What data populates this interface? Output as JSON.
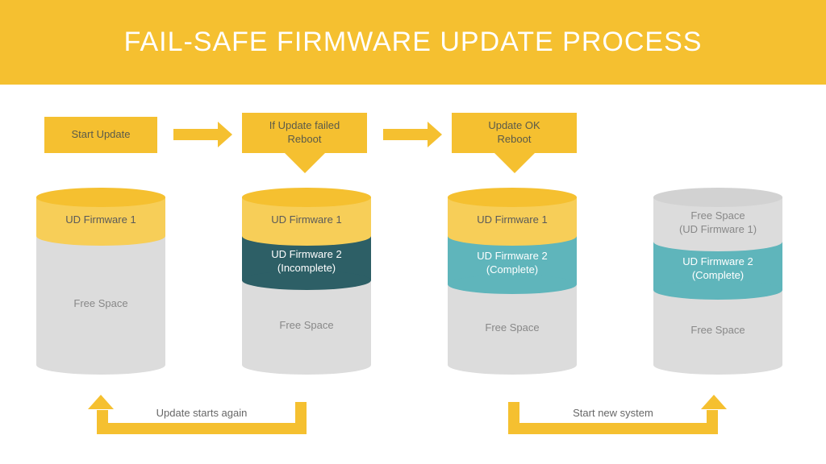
{
  "header": {
    "title": "FAIL-SAFE FIRMWARE UPDATE PROCESS"
  },
  "callouts": {
    "start": "Start Update",
    "failed_line1": "If Update failed",
    "failed_line2": "Reboot",
    "ok_line1": "Update OK",
    "ok_line2": "Reboot"
  },
  "cylinders": {
    "c1": {
      "seg1": "UD Firmware 1",
      "seg2": "Free Space"
    },
    "c2": {
      "seg1": "UD Firmware 1",
      "seg2_l1": "UD Firmware 2",
      "seg2_l2": "(Incomplete)",
      "seg3": "Free Space"
    },
    "c3": {
      "seg1": "UD Firmware 1",
      "seg2_l1": "UD Firmware 2",
      "seg2_l2": "(Complete)",
      "seg3": "Free Space"
    },
    "c4": {
      "seg1_l1": "Free Space",
      "seg1_l2": "(UD Firmware 1)",
      "seg2_l1": "UD Firmware 2",
      "seg2_l2": "(Complete)",
      "seg3": "Free Space"
    }
  },
  "bottom_labels": {
    "left": "Update starts again",
    "right": "Start new system"
  },
  "colors": {
    "accent": "#f5c030",
    "teal": "#5fb5bb",
    "darkteal": "#2d5f66",
    "gray": "#dcdcdc"
  }
}
